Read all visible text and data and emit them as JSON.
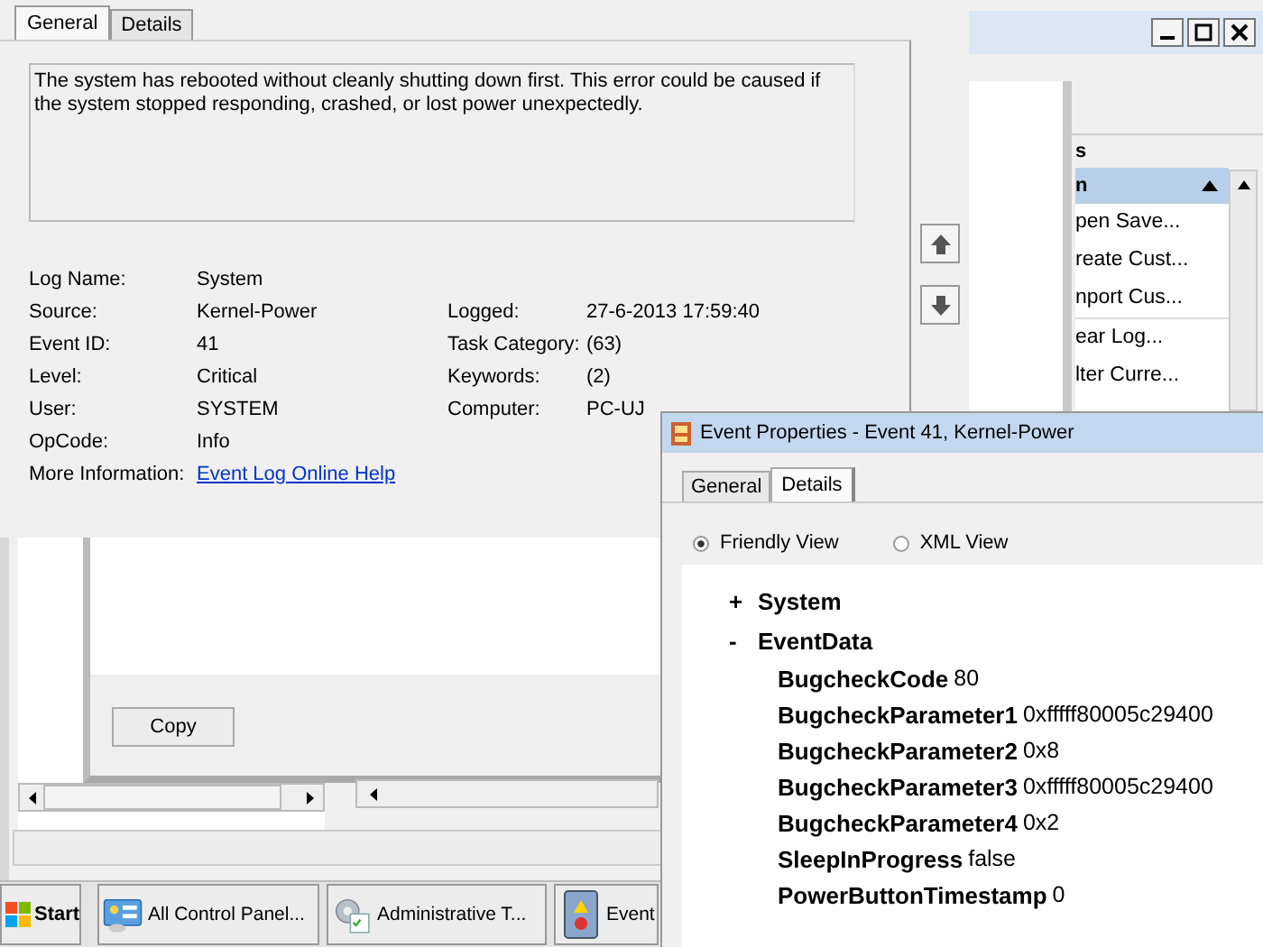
{
  "background_window": {
    "actions_pane": {
      "heading": "s",
      "selected_header": "n",
      "items": [
        "pen Save...",
        "reate Cust...",
        "nport Cus...",
        "ear Log...",
        "lter Curre..."
      ]
    }
  },
  "general_dialog": {
    "tabs": [
      {
        "label": "General",
        "selected": true
      },
      {
        "label": "Details",
        "selected": false
      }
    ],
    "description": "The system has rebooted without cleanly shutting down first. This error could be caused if the system stopped responding, crashed, or lost power unexpectedly.",
    "left_fields": [
      {
        "label": "Log Name:",
        "value": "System"
      },
      {
        "label": "Source:",
        "value": "Kernel-Power"
      },
      {
        "label": "Event ID:",
        "value": "41"
      },
      {
        "label": "Level:",
        "value": "Critical"
      },
      {
        "label": "User:",
        "value": "SYSTEM"
      },
      {
        "label": "OpCode:",
        "value": "Info"
      }
    ],
    "right_fields": [
      {
        "label": "Logged:",
        "value": "27-6-2013 17:59:40"
      },
      {
        "label": "Task Category:",
        "value": "(63)"
      },
      {
        "label": "Keywords:",
        "value": "(2)"
      },
      {
        "label": "Computer:",
        "value": "PC-UJ"
      }
    ],
    "more_information": {
      "label": "More Information:",
      "link": "Event Log Online Help"
    }
  },
  "copy_panel": {
    "button": "Copy"
  },
  "taskbar": {
    "start": "Start",
    "buttons": [
      {
        "label": "All Control Panel...",
        "kind": "control-panel"
      },
      {
        "label": "Administrative T...",
        "kind": "admin-tools"
      },
      {
        "label": "Event",
        "kind": "event-viewer"
      }
    ]
  },
  "event_properties": {
    "title": "Event Properties - Event 41, Kernel-Power",
    "tabs": [
      {
        "label": "General",
        "selected": false
      },
      {
        "label": "Details",
        "selected": true
      }
    ],
    "views": [
      {
        "label": "Friendly View",
        "selected": true
      },
      {
        "label": "XML View",
        "selected": false
      }
    ],
    "tree": [
      {
        "toggle": "+",
        "label": "System"
      },
      {
        "toggle": "-",
        "label": "EventData",
        "children": [
          {
            "name": "BugcheckCode",
            "value": "80"
          },
          {
            "name": "BugcheckParameter1",
            "value": "0xfffff80005c29400"
          },
          {
            "name": "BugcheckParameter2",
            "value": "0x8"
          },
          {
            "name": "BugcheckParameter3",
            "value": "0xfffff80005c29400"
          },
          {
            "name": "BugcheckParameter4",
            "value": "0x2"
          },
          {
            "name": "SleepInProgress",
            "value": "false"
          },
          {
            "name": "PowerButtonTimestamp",
            "value": "0"
          }
        ]
      }
    ]
  }
}
